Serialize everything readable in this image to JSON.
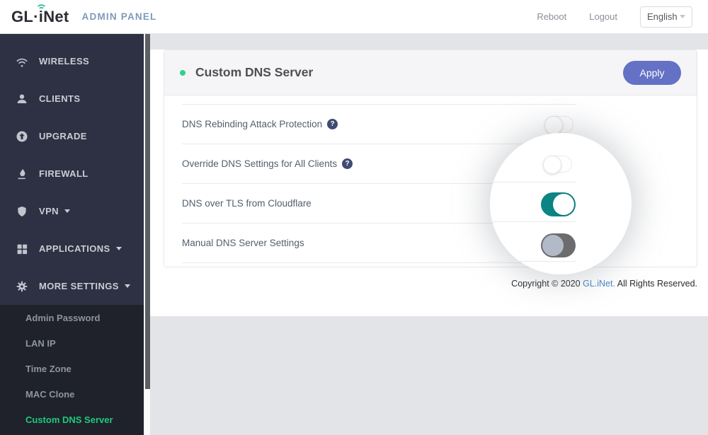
{
  "header": {
    "logo_left": "GL·",
    "logo_right": "iNet",
    "app_title": "ADMIN PANEL",
    "reboot_label": "Reboot",
    "logout_label": "Logout",
    "language_selected": "English"
  },
  "sidebar": {
    "items": [
      {
        "label": "WIRELESS",
        "icon": "wifi-icon",
        "has_submenu": false
      },
      {
        "label": "CLIENTS",
        "icon": "clients-icon",
        "has_submenu": false
      },
      {
        "label": "UPGRADE",
        "icon": "upgrade-icon",
        "has_submenu": false
      },
      {
        "label": "FIREWALL",
        "icon": "firewall-icon",
        "has_submenu": false
      },
      {
        "label": "VPN",
        "icon": "vpn-shield-icon",
        "has_submenu": true
      },
      {
        "label": "APPLICATIONS",
        "icon": "applications-grid-icon",
        "has_submenu": true
      },
      {
        "label": "MORE SETTINGS",
        "icon": "gear-icon",
        "has_submenu": true
      }
    ],
    "submenu": [
      {
        "label": "Admin Password",
        "active": false
      },
      {
        "label": "LAN IP",
        "active": false
      },
      {
        "label": "Time Zone",
        "active": false
      },
      {
        "label": "MAC Clone",
        "active": false
      },
      {
        "label": "Custom DNS Server",
        "active": true
      }
    ]
  },
  "main": {
    "card": {
      "title": "Custom DNS Server",
      "apply_label": "Apply",
      "help_glyph": "?",
      "rows": [
        {
          "label": "DNS Rebinding Attack Protection",
          "has_help": true,
          "state": "off"
        },
        {
          "label": "Override DNS Settings for All Clients",
          "has_help": true,
          "state": "off"
        },
        {
          "label": "DNS over TLS from Cloudflare",
          "has_help": false,
          "state": "on"
        },
        {
          "label": "Manual DNS Server Settings",
          "has_help": false,
          "state": "off"
        }
      ]
    },
    "copyright": {
      "pre": "Copyright © 2020 ",
      "link": "GL.iNet.",
      "post": " All Rights Reserved."
    }
  },
  "colors": {
    "toggle_on_teal": "#0a8583",
    "active_menu_green": "#1ec97e",
    "apply_purple": "#6471c5",
    "sidebar_bg": "#2d3143",
    "status_dot_green": "#2fd08c"
  }
}
